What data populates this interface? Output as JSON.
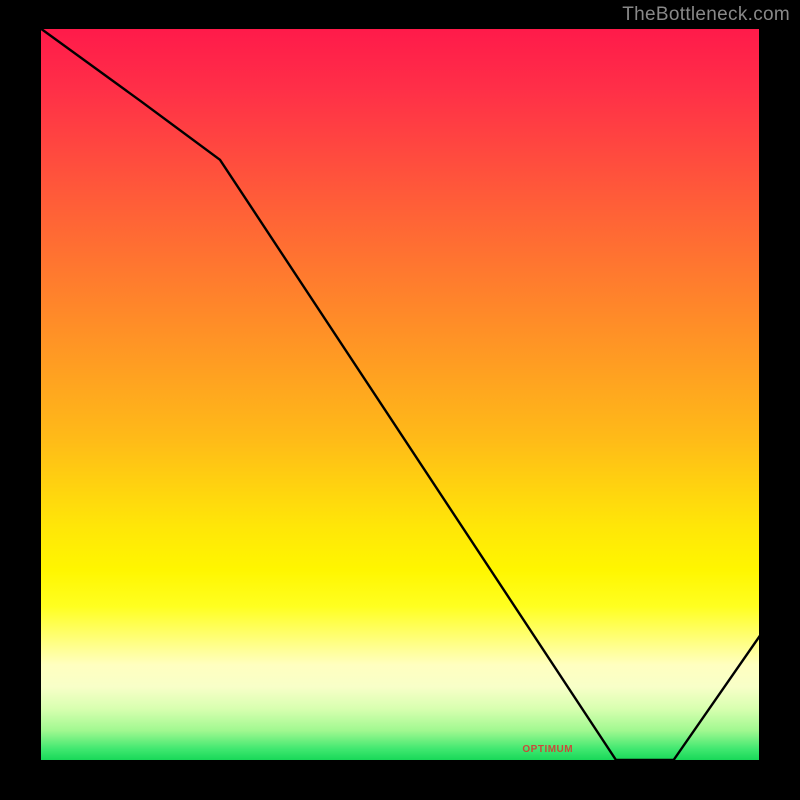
{
  "watermark": "TheBottleneck.com",
  "marker_label": "OPTIMUM",
  "chart_data": {
    "type": "line",
    "title": "",
    "xlabel": "",
    "ylabel": "",
    "xlim": [
      0,
      100
    ],
    "ylim": [
      0,
      100
    ],
    "x": [
      0,
      14,
      25,
      80,
      88,
      100
    ],
    "values": [
      100,
      90,
      82,
      0,
      0,
      17
    ],
    "gradient_colors": {
      "top": "#ff1a4a",
      "mid": "#fff600",
      "bottom": "#18d858"
    },
    "optimum_x_range": [
      75,
      88
    ],
    "notes": "Line chart on a vertical red-yellow-green gradient. Curve descends from top-left, flattens at bottom near x≈80–88 (optimum zone), then rises toward the right edge."
  }
}
